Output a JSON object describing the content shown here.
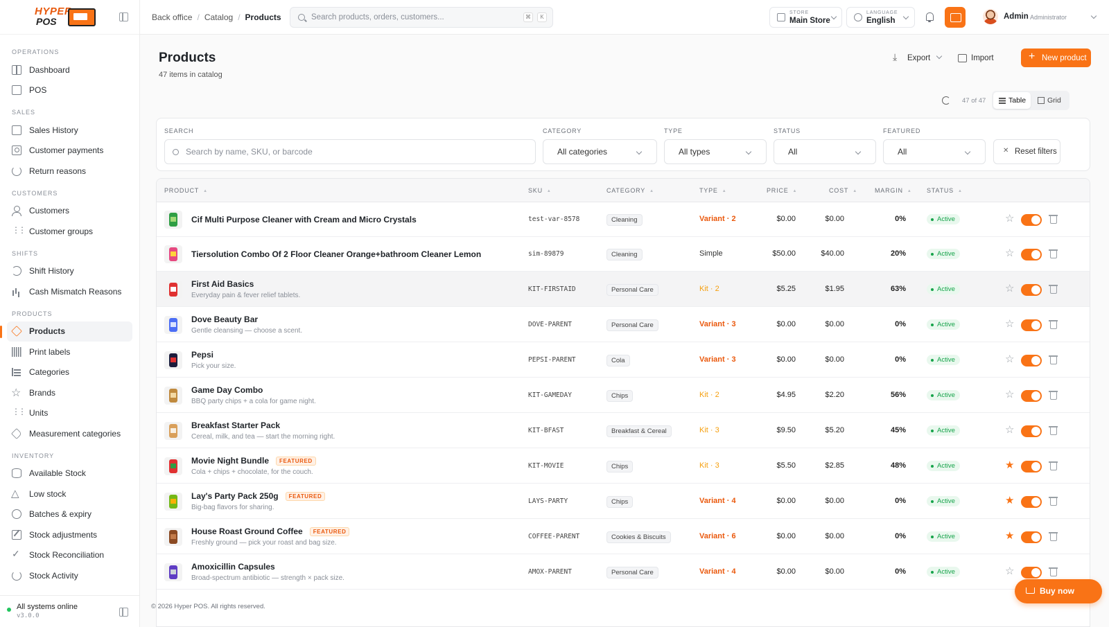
{
  "brand": {
    "logo_text_1": "HYPER",
    "logo_text_2": "POS"
  },
  "sidebar": {
    "sections": [
      {
        "title": "OPERATIONS",
        "items": [
          {
            "label": "Dashboard",
            "icon": "dashboard-icon"
          },
          {
            "label": "POS",
            "icon": "pos-terminal-icon"
          }
        ]
      },
      {
        "title": "SALES",
        "items": [
          {
            "label": "Sales History",
            "icon": "receipt-icon"
          },
          {
            "label": "Customer payments",
            "icon": "cash-icon"
          },
          {
            "label": "Return reasons",
            "icon": "return-icon"
          }
        ]
      },
      {
        "title": "CUSTOMERS",
        "items": [
          {
            "label": "Customers",
            "icon": "users-icon"
          },
          {
            "label": "Customer groups",
            "icon": "group-icon"
          }
        ]
      },
      {
        "title": "SHIFTS",
        "items": [
          {
            "label": "Shift History",
            "icon": "history-icon"
          },
          {
            "label": "Cash Mismatch Reasons",
            "icon": "chart-bars-icon"
          }
        ]
      },
      {
        "title": "PRODUCTS",
        "items": [
          {
            "label": "Products",
            "icon": "cube-icon",
            "active": true
          },
          {
            "label": "Print labels",
            "icon": "barcode-icon"
          },
          {
            "label": "Categories",
            "icon": "categories-icon"
          },
          {
            "label": "Brands",
            "icon": "star-icon"
          },
          {
            "label": "Units",
            "icon": "units-icon"
          },
          {
            "label": "Measurement categories",
            "icon": "tag-icon"
          }
        ]
      },
      {
        "title": "INVENTORY",
        "items": [
          {
            "label": "Available Stock",
            "icon": "database-icon"
          },
          {
            "label": "Low stock",
            "icon": "warning-icon"
          },
          {
            "label": "Batches & expiry",
            "icon": "clock-icon"
          },
          {
            "label": "Stock adjustments",
            "icon": "edit-icon"
          },
          {
            "label": "Stock Reconciliation",
            "icon": "check-icon"
          },
          {
            "label": "Stock Activity",
            "icon": "refresh-icon"
          }
        ]
      }
    ],
    "footer": {
      "status": "All systems online",
      "version": "v3.0.0"
    }
  },
  "topbar": {
    "breadcrumbs": [
      "Back office",
      "Catalog",
      "Products"
    ],
    "search_placeholder": "Search products, orders, customers...",
    "kbd": [
      "⌘",
      "K"
    ],
    "store_caption": "STORE",
    "store_value": "Main Store",
    "language_caption": "LANGUAGE",
    "language_value": "English",
    "user_name": "Admin",
    "user_role": "Administrator"
  },
  "page": {
    "title": "Products",
    "subtitle": "47 items in catalog",
    "export_label": "Export",
    "import_label": "Import",
    "new_label": "New product",
    "count": "47 of 47",
    "view_table": "Table",
    "view_grid": "Grid"
  },
  "filters": {
    "search_label": "SEARCH",
    "search_placeholder": "Search by name, SKU, or barcode",
    "category_label": "CATEGORY",
    "category_value": "All categories",
    "type_label": "TYPE",
    "type_value": "All types",
    "status_label": "STATUS",
    "status_value": "All",
    "featured_label": "FEATURED",
    "featured_value": "All",
    "reset_label": "Reset filters"
  },
  "table": {
    "columns": [
      "PRODUCT",
      "SKU",
      "CATEGORY",
      "TYPE",
      "PRICE",
      "COST",
      "MARGIN",
      "STATUS"
    ],
    "rows": [
      {
        "name": "Cif Multi Purpose Cleaner with Cream and Micro Crystals",
        "desc": "",
        "featured": false,
        "sku": "test-var-8578",
        "category": "Cleaning",
        "type": "Variant · 2",
        "type_kind": "variant",
        "price": "$0.00",
        "cost": "$0.00",
        "margin": "0%",
        "status": "Active",
        "starred": false,
        "enabled": true
      },
      {
        "name": "Tiersolution Combo Of 2 Floor Cleaner Orange+bathroom Cleaner Lemon",
        "desc": "",
        "featured": false,
        "sku": "sim-89879",
        "category": "Cleaning",
        "type": "Simple",
        "type_kind": "simple",
        "price": "$50.00",
        "cost": "$40.00",
        "margin": "20%",
        "status": "Active",
        "starred": false,
        "enabled": true
      },
      {
        "name": "First Aid Basics",
        "desc": "Everyday pain & fever relief tablets.",
        "featured": false,
        "sku": "KIT-FIRSTAID",
        "category": "Personal Care",
        "type": "Kit · 2",
        "type_kind": "kit",
        "price": "$5.25",
        "cost": "$1.95",
        "margin": "63%",
        "status": "Active",
        "starred": false,
        "enabled": true,
        "highlight": true
      },
      {
        "name": "Dove Beauty Bar",
        "desc": "Gentle cleansing — choose a scent.",
        "featured": false,
        "sku": "DOVE-PARENT",
        "category": "Personal Care",
        "type": "Variant · 3",
        "type_kind": "variant",
        "price": "$0.00",
        "cost": "$0.00",
        "margin": "0%",
        "status": "Active",
        "starred": false,
        "enabled": true
      },
      {
        "name": "Pepsi",
        "desc": "Pick your size.",
        "featured": false,
        "sku": "PEPSI-PARENT",
        "category": "Cola",
        "type": "Variant · 3",
        "type_kind": "variant",
        "price": "$0.00",
        "cost": "$0.00",
        "margin": "0%",
        "status": "Active",
        "starred": false,
        "enabled": true
      },
      {
        "name": "Game Day Combo",
        "desc": "BBQ party chips + a cola for game night.",
        "featured": false,
        "sku": "KIT-GAMEDAY",
        "category": "Chips",
        "type": "Kit · 2",
        "type_kind": "kit",
        "price": "$4.95",
        "cost": "$2.20",
        "margin": "56%",
        "status": "Active",
        "starred": false,
        "enabled": true
      },
      {
        "name": "Breakfast Starter Pack",
        "desc": "Cereal, milk, and tea — start the morning right.",
        "featured": false,
        "sku": "KIT-BFAST",
        "category": "Breakfast & Cereal",
        "type": "Kit · 3",
        "type_kind": "kit",
        "price": "$9.50",
        "cost": "$5.20",
        "margin": "45%",
        "status": "Active",
        "starred": false,
        "enabled": true
      },
      {
        "name": "Movie Night Bundle",
        "desc": "Cola + chips + chocolate, for the couch.",
        "featured": true,
        "sku": "KIT-MOVIE",
        "category": "Chips",
        "type": "Kit · 3",
        "type_kind": "kit",
        "price": "$5.50",
        "cost": "$2.85",
        "margin": "48%",
        "status": "Active",
        "starred": true,
        "enabled": true
      },
      {
        "name": "Lay's Party Pack 250g",
        "desc": "Big-bag flavors for sharing.",
        "featured": true,
        "sku": "LAYS-PARTY",
        "category": "Chips",
        "type": "Variant · 4",
        "type_kind": "variant",
        "price": "$0.00",
        "cost": "$0.00",
        "margin": "0%",
        "status": "Active",
        "starred": true,
        "enabled": true
      },
      {
        "name": "House Roast Ground Coffee",
        "desc": "Freshly ground — pick your roast and bag size.",
        "featured": true,
        "sku": "COFFEE-PARENT",
        "category": "Cookies & Biscuits",
        "type": "Variant · 6",
        "type_kind": "variant",
        "price": "$0.00",
        "cost": "$0.00",
        "margin": "0%",
        "status": "Active",
        "starred": true,
        "enabled": true
      },
      {
        "name": "Amoxicillin Capsules",
        "desc": "Broad-spectrum antibiotic — strength × pack size.",
        "featured": false,
        "sku": "AMOX-PARENT",
        "category": "Personal Care",
        "type": "Variant · 4",
        "type_kind": "variant",
        "price": "$0.00",
        "cost": "$0.00",
        "margin": "0%",
        "status": "Active",
        "starred": false,
        "enabled": true
      }
    ],
    "featured_badge": "FEATURED"
  },
  "footer": {
    "copyright": "© 2026 Hyper POS. All rights reserved.",
    "buy_now": "Buy now"
  },
  "colors": {
    "accent": "#f97316",
    "success": "#16a34a"
  }
}
